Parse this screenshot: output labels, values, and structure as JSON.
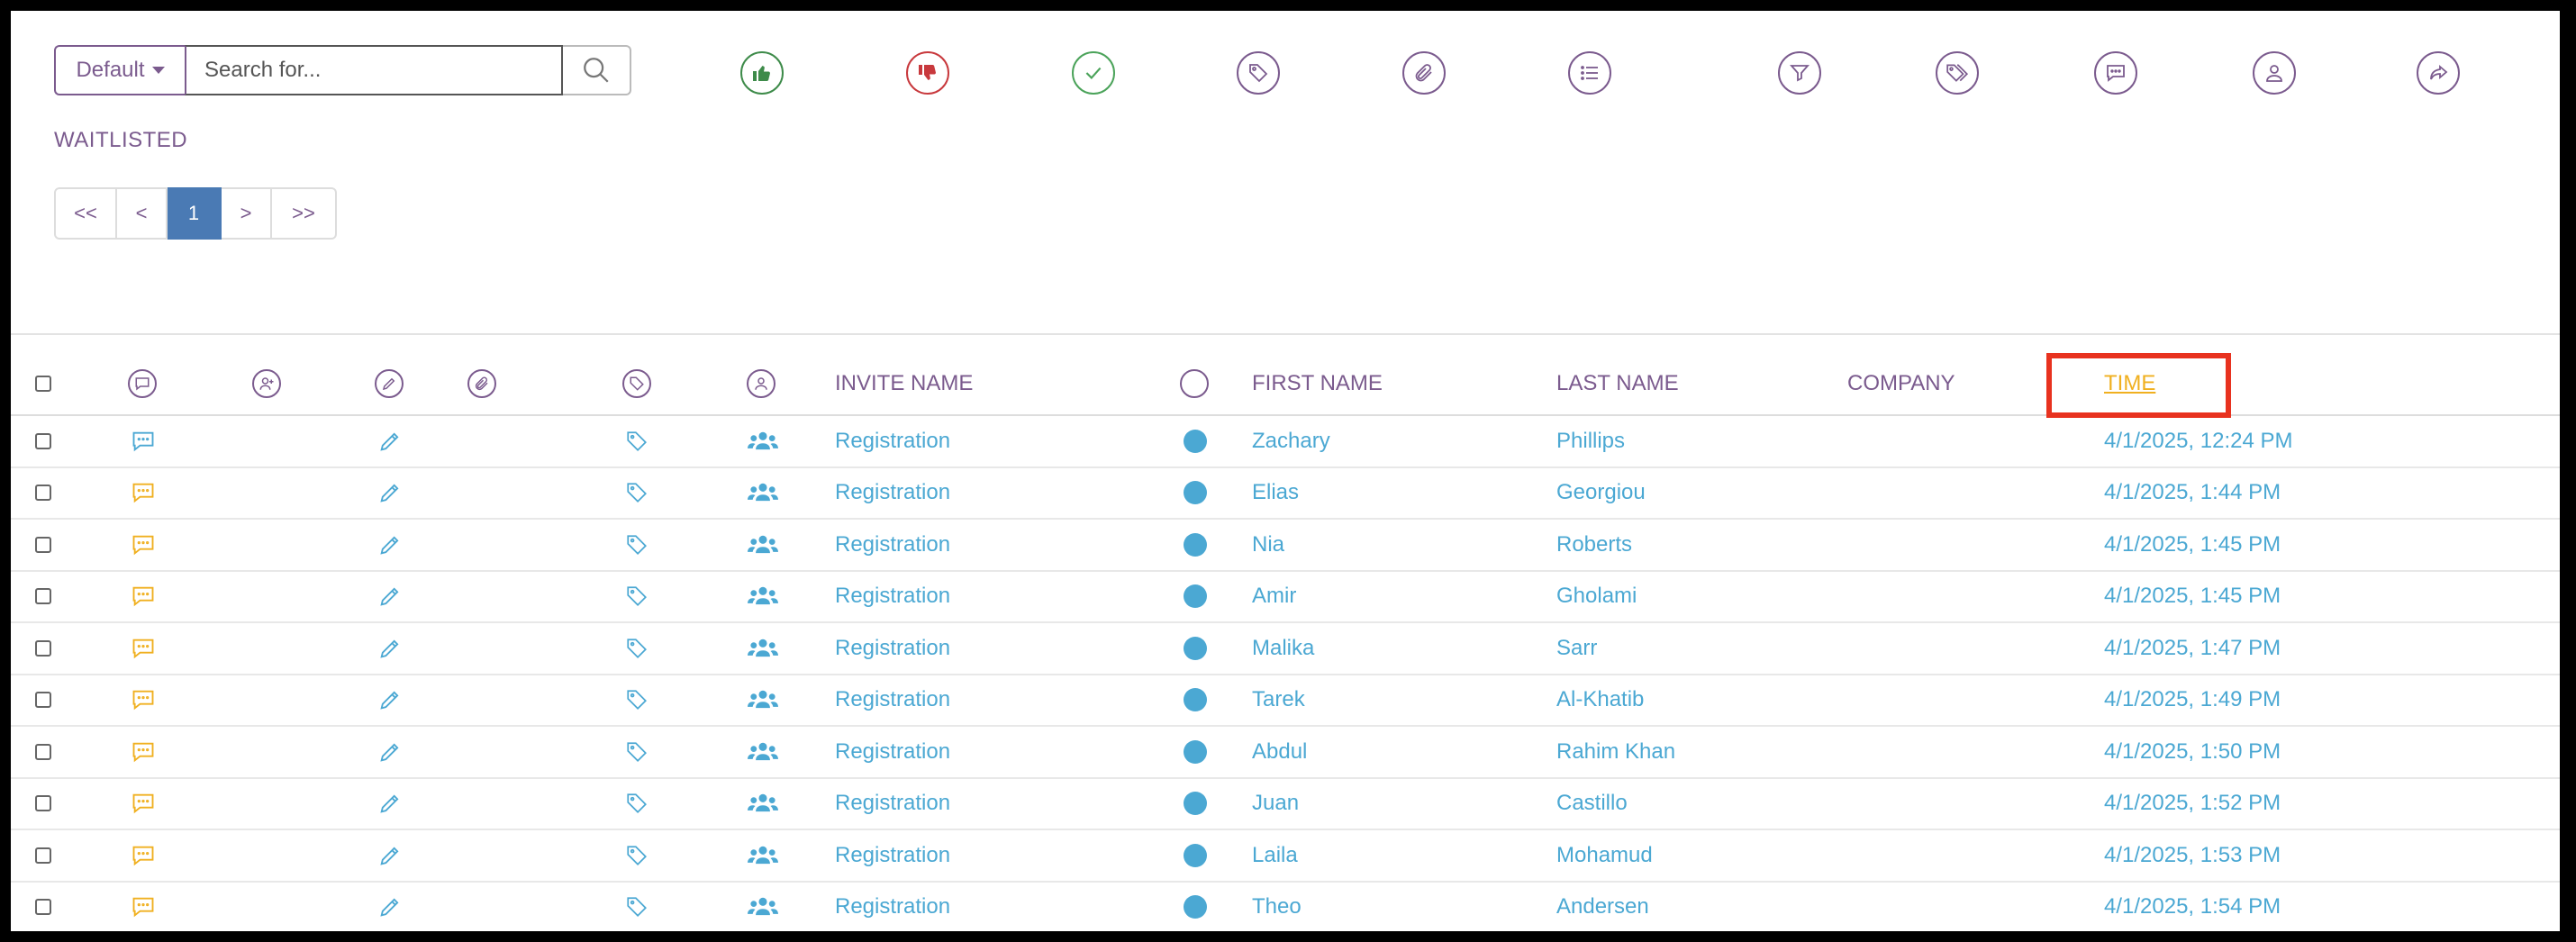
{
  "toolbar": {
    "filter_default": "Default",
    "search_placeholder": "Search for...",
    "icons": [
      "thumbs-up-icon",
      "thumbs-down-icon",
      "check-icon",
      "tag-icon",
      "paperclip-icon",
      "list-icon",
      "filter-icon",
      "tags-icon",
      "comment-icon",
      "user-icon",
      "share-icon"
    ]
  },
  "status_label": "WAITLISTED",
  "pagination": {
    "first": "<<",
    "prev": "<",
    "current": "1",
    "next": ">",
    "last": ">>"
  },
  "table": {
    "columns": {
      "invite_name": "INVITE NAME",
      "first_name": "FIRST NAME",
      "last_name": "LAST NAME",
      "company": "COMPANY",
      "time": "TIME"
    },
    "rows": [
      {
        "invite": "Registration",
        "first": "Zachary",
        "last": "Phillips",
        "company": "",
        "time": "4/1/2025, 12:24 PM",
        "comment_color": "blue"
      },
      {
        "invite": "Registration",
        "first": "Elias",
        "last": "Georgiou",
        "company": "",
        "time": "4/1/2025, 1:44 PM",
        "comment_color": "yellow"
      },
      {
        "invite": "Registration",
        "first": "Nia",
        "last": "Roberts",
        "company": "",
        "time": "4/1/2025, 1:45 PM",
        "comment_color": "yellow"
      },
      {
        "invite": "Registration",
        "first": "Amir",
        "last": "Gholami",
        "company": "",
        "time": "4/1/2025, 1:45 PM",
        "comment_color": "yellow"
      },
      {
        "invite": "Registration",
        "first": "Malika",
        "last": "Sarr",
        "company": "",
        "time": "4/1/2025, 1:47 PM",
        "comment_color": "yellow"
      },
      {
        "invite": "Registration",
        "first": "Tarek",
        "last": "Al-Khatib",
        "company": "",
        "time": "4/1/2025, 1:49 PM",
        "comment_color": "yellow"
      },
      {
        "invite": "Registration",
        "first": "Abdul",
        "last": "Rahim Khan",
        "company": "",
        "time": "4/1/2025, 1:50 PM",
        "comment_color": "yellow"
      },
      {
        "invite": "Registration",
        "first": "Juan",
        "last": "Castillo",
        "company": "",
        "time": "4/1/2025, 1:52 PM",
        "comment_color": "yellow"
      },
      {
        "invite": "Registration",
        "first": "Laila",
        "last": "Mohamud",
        "company": "",
        "time": "4/1/2025, 1:53 PM",
        "comment_color": "yellow"
      },
      {
        "invite": "Registration",
        "first": "Theo",
        "last": "Andersen",
        "company": "",
        "time": "4/1/2025, 1:54 PM",
        "comment_color": "yellow"
      }
    ]
  },
  "colors": {
    "purple": "#7b5b8e",
    "link_blue": "#4ba8d3",
    "comment_yellow": "#f0b020",
    "sort_active": "#f0b020",
    "highlight": "#e8321f"
  }
}
